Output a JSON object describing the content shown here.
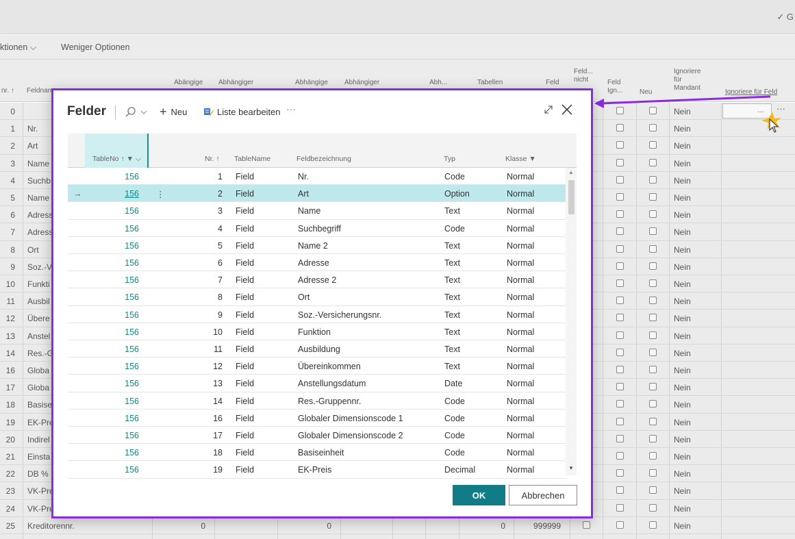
{
  "background": {
    "topbar_right": "✓ G",
    "actions": [
      "ktionen ⌵",
      "Weniger Optionen"
    ],
    "headers": {
      "nr": "nr. ↑",
      "feldname": "Feldnam",
      "abh1": "Abängige",
      "abh2": "Abhängiger",
      "abh3": "Abhängige",
      "abh4": "Abhängiger",
      "abh5": "Abh...",
      "tabellen": "Tabellen",
      "feld": "Feld",
      "feld_nicht": "Feld... nicht",
      "feld_ign": "Feld Ign...",
      "neu": "Neu",
      "ignoriere_mandant": "Ignoriere für Mandant",
      "ignoriere_feld": "Ignoriere für Feld"
    },
    "input_ellipsis": "...",
    "more_ellipsis": "···",
    "rows": [
      {
        "num": "0",
        "name": "",
        "nein": "Nein"
      },
      {
        "num": "1",
        "name": "Nr.",
        "nein": "Nein"
      },
      {
        "num": "2",
        "name": "Art",
        "nein": "Nein"
      },
      {
        "num": "3",
        "name": "Name",
        "nein": "Nein"
      },
      {
        "num": "4",
        "name": "Suchb",
        "nein": "Nein"
      },
      {
        "num": "5",
        "name": "Name",
        "nein": "Nein"
      },
      {
        "num": "6",
        "name": "Adress",
        "nein": "Nein"
      },
      {
        "num": "7",
        "name": "Adress",
        "nein": "Nein"
      },
      {
        "num": "8",
        "name": "Ort",
        "nein": "Nein"
      },
      {
        "num": "9",
        "name": "Soz.-V",
        "nein": "Nein"
      },
      {
        "num": "10",
        "name": "Funkti",
        "nein": "Nein"
      },
      {
        "num": "11",
        "name": "Ausbil",
        "nein": "Nein"
      },
      {
        "num": "12",
        "name": "Übere",
        "nein": "Nein"
      },
      {
        "num": "13",
        "name": "Anstel",
        "nein": "Nein"
      },
      {
        "num": "14",
        "name": "Res.-G",
        "nein": "Nein"
      },
      {
        "num": "16",
        "name": "Globa",
        "nein": "Nein"
      },
      {
        "num": "17",
        "name": "Globa",
        "nein": "Nein"
      },
      {
        "num": "18",
        "name": "Basise",
        "nein": "Nein"
      },
      {
        "num": "19",
        "name": "EK-Pre",
        "nein": "Nein"
      },
      {
        "num": "20",
        "name": "Indirel",
        "nein": "Nein"
      },
      {
        "num": "21",
        "name": "Einsta",
        "nein": "Nein"
      },
      {
        "num": "22",
        "name": "DB %",
        "nein": "Nein"
      },
      {
        "num": "23",
        "name": "VK-Pre",
        "nein": "Nein"
      },
      {
        "num": "24",
        "name": "VK-Pre",
        "nein": "Nein"
      },
      {
        "num": "25",
        "name": "Kreditorennr.",
        "nein": "Nein"
      }
    ],
    "last_row_values": {
      "v1": "0",
      "v2": "0",
      "v3": "0",
      "v4": "999999"
    }
  },
  "modal": {
    "title": "Felder",
    "new_label": "Neu",
    "edit_label": "Liste bearbeiten",
    "more": "···",
    "columns": {
      "tableno": "TableNo ↑ ▼ ⌵",
      "nr": "Nr. ↑",
      "tablename": "TableName",
      "feldbezeichnung": "Feldbezeichnung",
      "typ": "Typ",
      "klasse": "Klasse ▼"
    },
    "rows": [
      {
        "tn": "156",
        "nr": "1",
        "tbl": "Field",
        "fb": "Nr.",
        "typ": "Code",
        "kl": "Normal"
      },
      {
        "tn": "156",
        "nr": "2",
        "tbl": "Field",
        "fb": "Art",
        "typ": "Option",
        "kl": "Normal",
        "selected": true
      },
      {
        "tn": "156",
        "nr": "3",
        "tbl": "Field",
        "fb": "Name",
        "typ": "Text",
        "kl": "Normal"
      },
      {
        "tn": "156",
        "nr": "4",
        "tbl": "Field",
        "fb": "Suchbegriff",
        "typ": "Code",
        "kl": "Normal"
      },
      {
        "tn": "156",
        "nr": "5",
        "tbl": "Field",
        "fb": "Name 2",
        "typ": "Text",
        "kl": "Normal"
      },
      {
        "tn": "156",
        "nr": "6",
        "tbl": "Field",
        "fb": "Adresse",
        "typ": "Text",
        "kl": "Normal"
      },
      {
        "tn": "156",
        "nr": "7",
        "tbl": "Field",
        "fb": "Adresse 2",
        "typ": "Text",
        "kl": "Normal"
      },
      {
        "tn": "156",
        "nr": "8",
        "tbl": "Field",
        "fb": "Ort",
        "typ": "Text",
        "kl": "Normal"
      },
      {
        "tn": "156",
        "nr": "9",
        "tbl": "Field",
        "fb": "Soz.-Versicherungsnr.",
        "typ": "Text",
        "kl": "Normal"
      },
      {
        "tn": "156",
        "nr": "10",
        "tbl": "Field",
        "fb": "Funktion",
        "typ": "Text",
        "kl": "Normal"
      },
      {
        "tn": "156",
        "nr": "11",
        "tbl": "Field",
        "fb": "Ausbildung",
        "typ": "Text",
        "kl": "Normal"
      },
      {
        "tn": "156",
        "nr": "12",
        "tbl": "Field",
        "fb": "Übereinkommen",
        "typ": "Text",
        "kl": "Normal"
      },
      {
        "tn": "156",
        "nr": "13",
        "tbl": "Field",
        "fb": "Anstellungsdatum",
        "typ": "Date",
        "kl": "Normal"
      },
      {
        "tn": "156",
        "nr": "14",
        "tbl": "Field",
        "fb": "Res.-Gruppennr.",
        "typ": "Code",
        "kl": "Normal"
      },
      {
        "tn": "156",
        "nr": "16",
        "tbl": "Field",
        "fb": "Globaler Dimensionscode 1",
        "typ": "Code",
        "kl": "Normal"
      },
      {
        "tn": "156",
        "nr": "17",
        "tbl": "Field",
        "fb": "Globaler Dimensionscode 2",
        "typ": "Code",
        "kl": "Normal"
      },
      {
        "tn": "156",
        "nr": "18",
        "tbl": "Field",
        "fb": "Basiseinheit",
        "typ": "Code",
        "kl": "Normal"
      },
      {
        "tn": "156",
        "nr": "19",
        "tbl": "Field",
        "fb": "EK-Preis",
        "typ": "Decimal",
        "kl": "Normal"
      }
    ],
    "ok_label": "OK",
    "cancel_label": "Abbrechen"
  },
  "colors": {
    "accent": "#117c86",
    "link": "#0a8a8a",
    "selected_row": "#bde9ec",
    "annotation": "#8a2be2"
  }
}
